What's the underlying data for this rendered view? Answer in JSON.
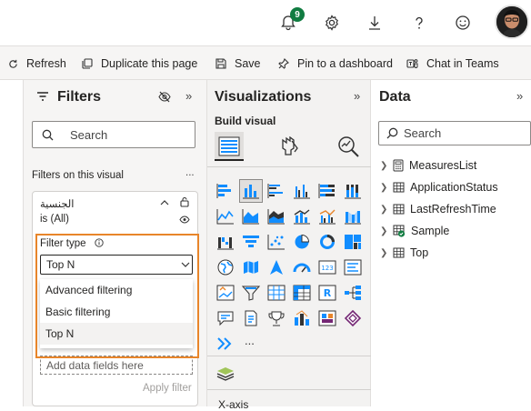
{
  "topbar": {
    "notification_count": "9",
    "icons": [
      "bell-icon",
      "gear-icon",
      "download-icon",
      "help-icon",
      "smiley-icon"
    ]
  },
  "commands": {
    "refresh": "Refresh",
    "duplicate": "Duplicate this page",
    "save": "Save",
    "pin": "Pin to a dashboard",
    "chat": "Chat in Teams"
  },
  "filters": {
    "title": "Filters",
    "search_placeholder": "Search",
    "section_label": "Filters on this visual",
    "more": "...",
    "field_name": "الجنسية",
    "field_state": "is (All)",
    "filter_type_label": "Filter type",
    "filter_type_value": "Top N",
    "options": [
      "Advanced filtering",
      "Basic filtering",
      "Top N"
    ],
    "add_fields_placeholder": "Add data fields here",
    "apply_label": "Apply filter"
  },
  "visualizations": {
    "title": "Visualizations",
    "build_visual": "Build visual",
    "more_visuals": "...",
    "x_axis_label": "X-axis"
  },
  "data": {
    "title": "Data",
    "search_placeholder": "Search",
    "tables": [
      "MeasuresList",
      "ApplicationStatus",
      "LastRefreshTime",
      "Sample",
      "Top"
    ]
  },
  "colors": {
    "accent_orange": "#e8852a",
    "green_badge": "#107c41",
    "pbi_teal": "#118dff"
  }
}
